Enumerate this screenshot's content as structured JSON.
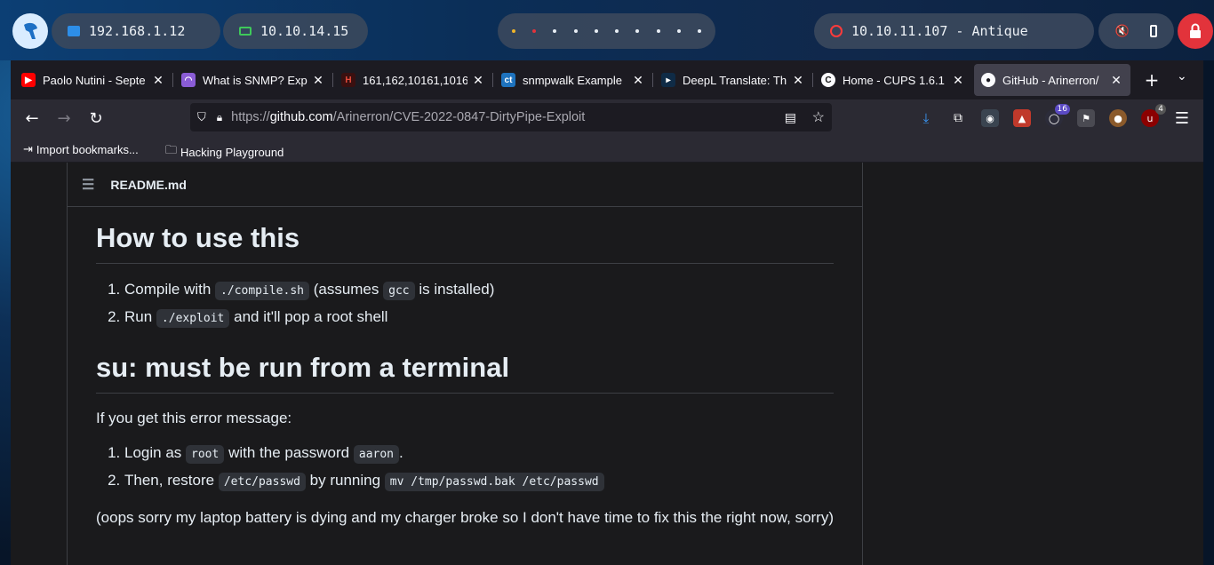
{
  "panel": {
    "ip_local": "192.168.1.12",
    "ip_vpn": "10.10.14.15",
    "target": "10.10.11.107 - Antique",
    "colors": {
      "local_icon": "#2d8ee8",
      "vpn_icon": "#3ec95a",
      "target_icon": "#ff3b3b",
      "lock_bg": "#e2333b"
    }
  },
  "tabs": [
    {
      "title": "Paolo Nutini - Septe",
      "favicon": "youtube-icon",
      "color": "#ff0000"
    },
    {
      "title": "What is SNMP? Expl",
      "favicon": "gauge-icon",
      "color": "#8a5cd6"
    },
    {
      "title": "161,162,10161,1016",
      "favicon": "hacktricks-icon",
      "color": "#c0392b"
    },
    {
      "title": "snmpwalk Example",
      "favicon": "ct-icon",
      "color": "#1e73be"
    },
    {
      "title": "DeepL Translate: Th",
      "favicon": "deepl-icon",
      "color": "#0f2b46"
    },
    {
      "title": "Home - CUPS 1.6.1",
      "favicon": "cups-icon",
      "color": "#111111"
    },
    {
      "title": "GitHub - Arinerron/",
      "favicon": "github-icon",
      "color": "#ffffff"
    }
  ],
  "url": {
    "scheme": "https://",
    "host": "github.com",
    "path": "/Arinerron/CVE-2022-0847-DirtyPipe-Exploit"
  },
  "toolbar": {
    "ext_badge_1": "16",
    "ext_badge_2": "4"
  },
  "bookmarks": [
    {
      "label": "Import bookmarks..."
    },
    {
      "label": "Hacking Playground"
    }
  ],
  "readme": {
    "filename": "README.md",
    "h_use": "How to use this",
    "use_1": {
      "pre": "Compile with",
      "code1": "./compile.sh",
      "mid": "(assumes",
      "code2": "gcc",
      "post": "is installed)"
    },
    "use_2": {
      "pre": "Run",
      "code1": "./exploit",
      "post": "and it'll pop a root shell"
    },
    "h_su": "su: must be run from a terminal",
    "su_intro": "If you get this error message:",
    "su_1": {
      "pre": "Login as",
      "code1": "root",
      "mid": "with the password",
      "code2": "aaron",
      "post": "."
    },
    "su_2": {
      "pre": "Then, restore",
      "code1": "/etc/passwd",
      "mid": "by running",
      "code2": "mv /tmp/passwd.bak /etc/passwd"
    },
    "note": "(oops sorry my laptop battery is dying and my charger broke so I don't have time to fix this the right now, sorry)"
  }
}
